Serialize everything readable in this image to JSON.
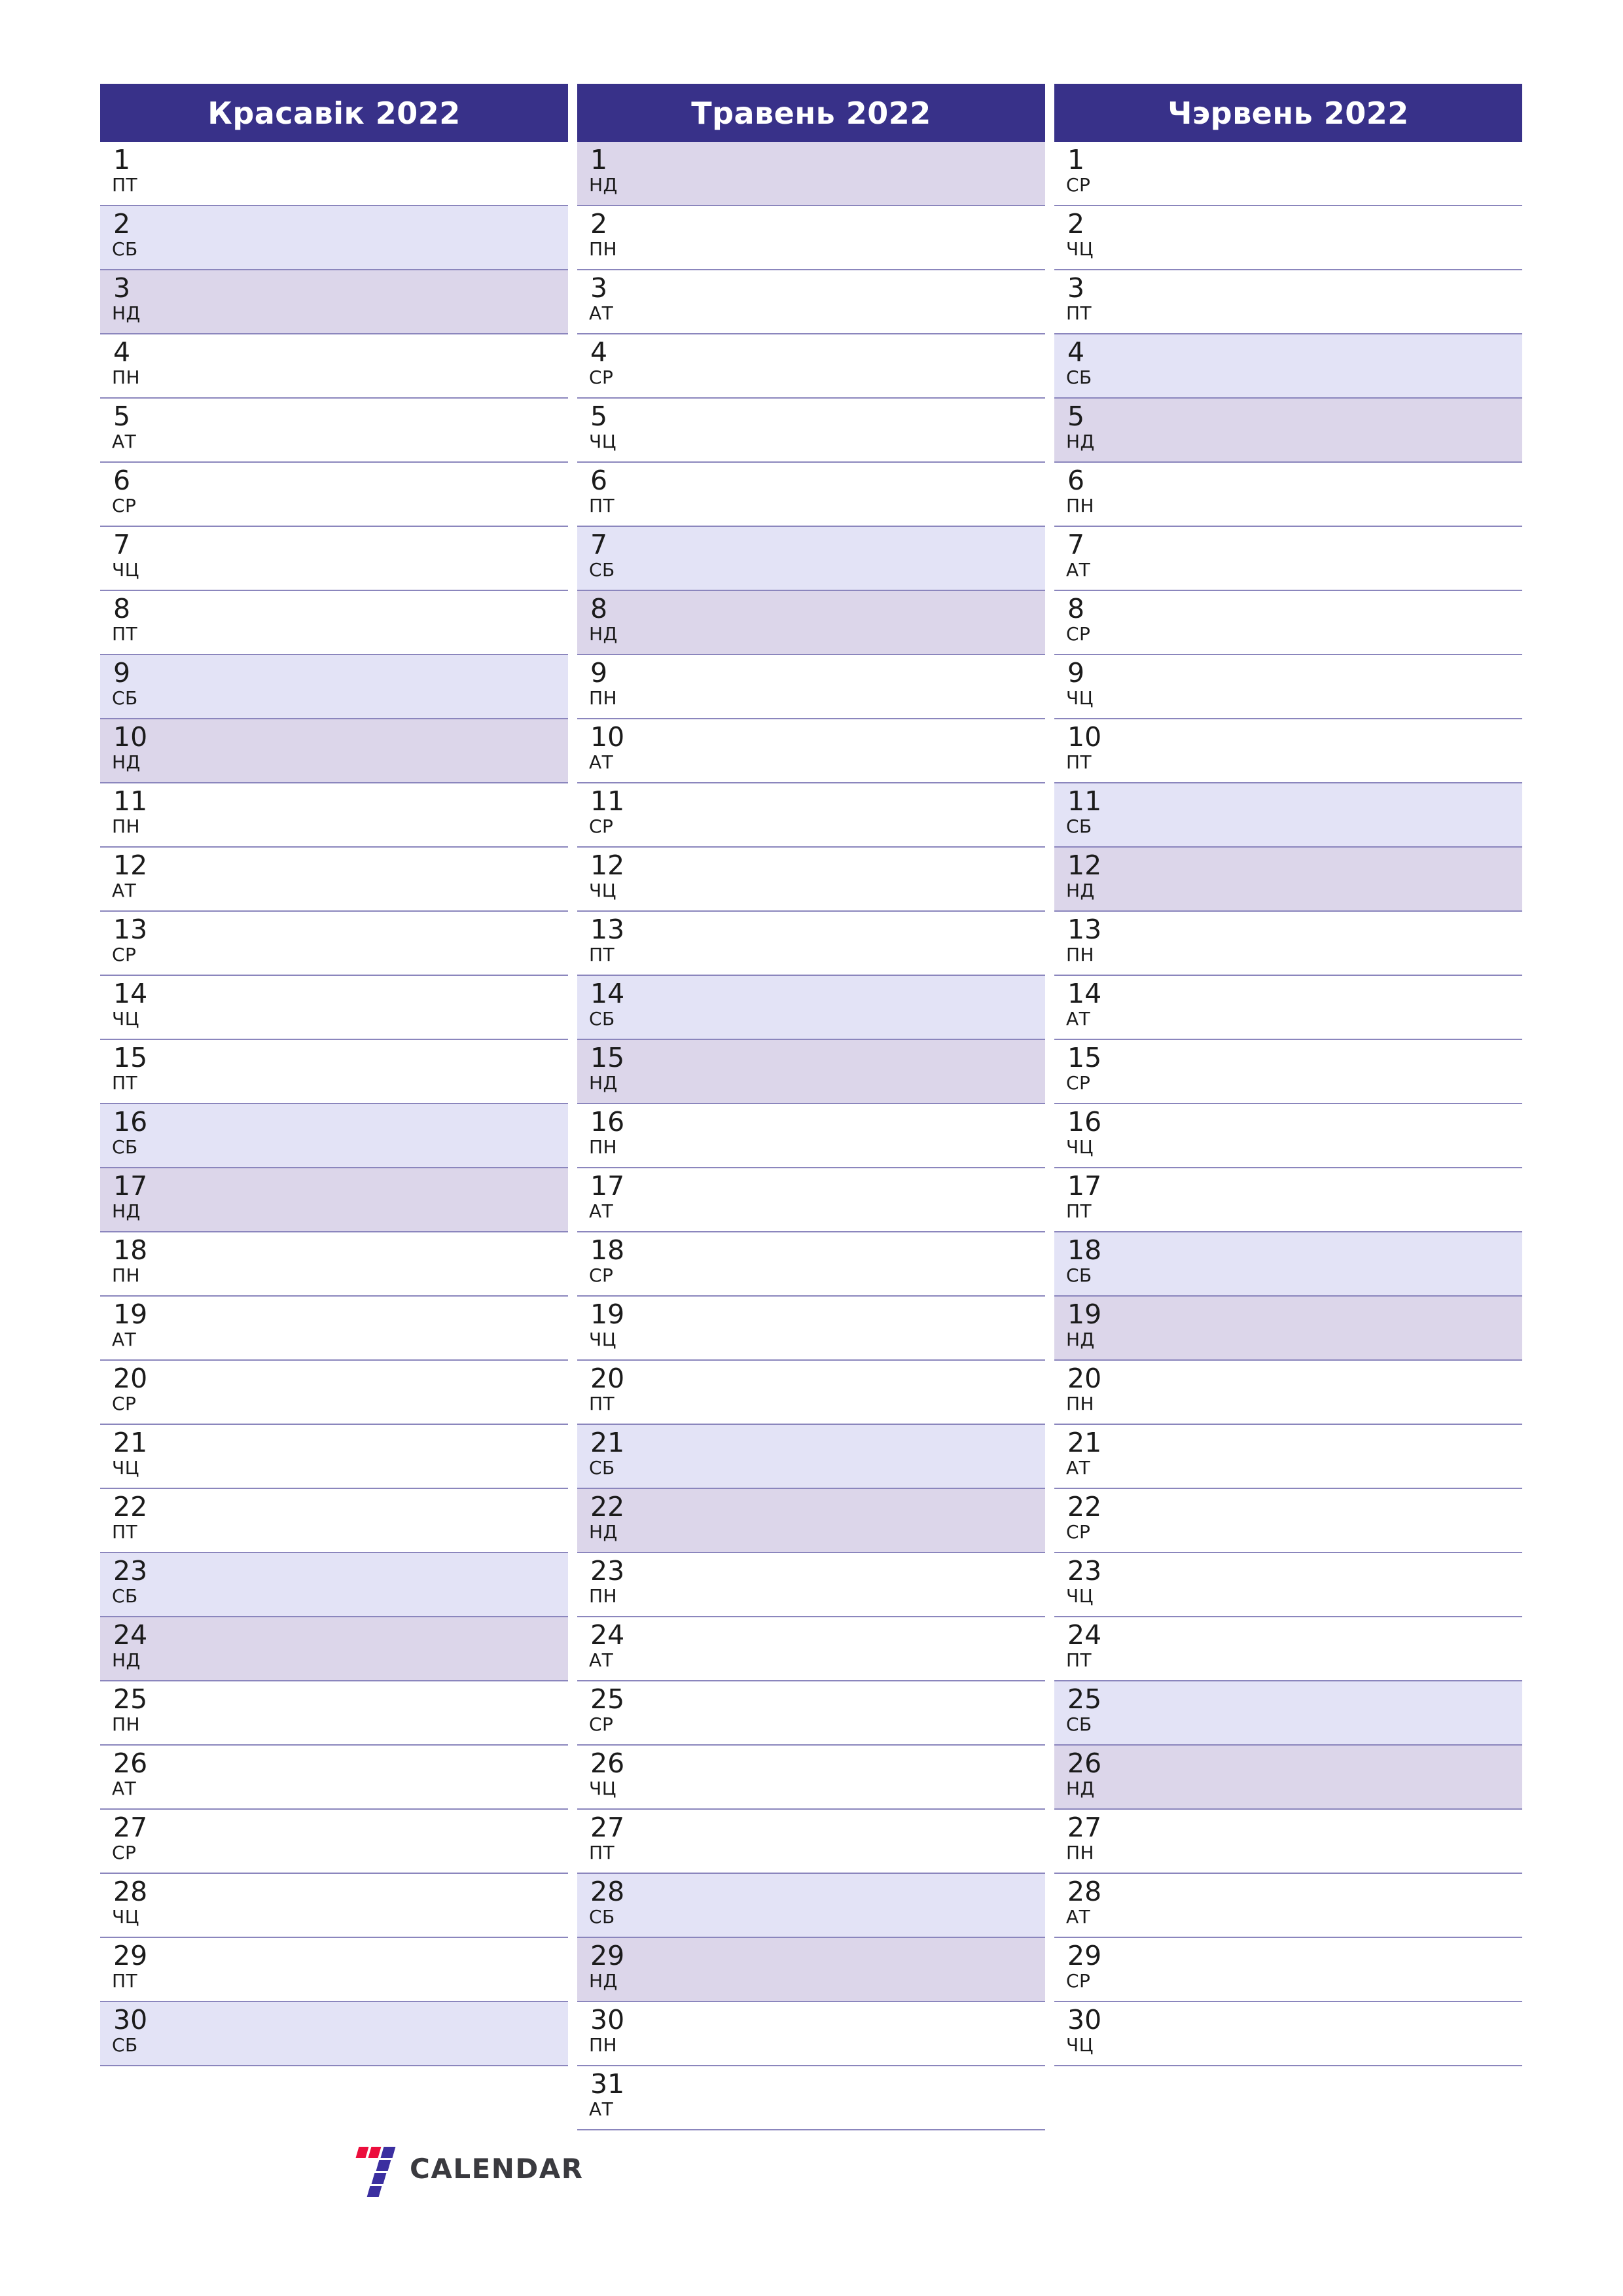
{
  "page": {
    "background_color": "#ffffff",
    "accent_color": "#383189",
    "saturday_color": "#e3e3f6",
    "sunday_color": "#dcd6ea",
    "divider_color": "#8b86bd",
    "text_color": "#1b1b1b"
  },
  "brand": {
    "logo_icon": "seven-calendar-logo-icon",
    "word": "CALENDAR",
    "mark_red": "#ec0e3c",
    "mark_purple": "#3b2fa0"
  },
  "months": [
    {
      "title": "Красавік 2022",
      "days": [
        {
          "num": "1",
          "dow": "ПТ",
          "kind": "weekday"
        },
        {
          "num": "2",
          "dow": "СБ",
          "kind": "sat"
        },
        {
          "num": "3",
          "dow": "НД",
          "kind": "sun"
        },
        {
          "num": "4",
          "dow": "ПН",
          "kind": "weekday"
        },
        {
          "num": "5",
          "dow": "АТ",
          "kind": "weekday"
        },
        {
          "num": "6",
          "dow": "СР",
          "kind": "weekday"
        },
        {
          "num": "7",
          "dow": "ЧЦ",
          "kind": "weekday"
        },
        {
          "num": "8",
          "dow": "ПТ",
          "kind": "weekday"
        },
        {
          "num": "9",
          "dow": "СБ",
          "kind": "sat"
        },
        {
          "num": "10",
          "dow": "НД",
          "kind": "sun"
        },
        {
          "num": "11",
          "dow": "ПН",
          "kind": "weekday"
        },
        {
          "num": "12",
          "dow": "АТ",
          "kind": "weekday"
        },
        {
          "num": "13",
          "dow": "СР",
          "kind": "weekday"
        },
        {
          "num": "14",
          "dow": "ЧЦ",
          "kind": "weekday"
        },
        {
          "num": "15",
          "dow": "ПТ",
          "kind": "weekday"
        },
        {
          "num": "16",
          "dow": "СБ",
          "kind": "sat"
        },
        {
          "num": "17",
          "dow": "НД",
          "kind": "sun"
        },
        {
          "num": "18",
          "dow": "ПН",
          "kind": "weekday"
        },
        {
          "num": "19",
          "dow": "АТ",
          "kind": "weekday"
        },
        {
          "num": "20",
          "dow": "СР",
          "kind": "weekday"
        },
        {
          "num": "21",
          "dow": "ЧЦ",
          "kind": "weekday"
        },
        {
          "num": "22",
          "dow": "ПТ",
          "kind": "weekday"
        },
        {
          "num": "23",
          "dow": "СБ",
          "kind": "sat"
        },
        {
          "num": "24",
          "dow": "НД",
          "kind": "sun"
        },
        {
          "num": "25",
          "dow": "ПН",
          "kind": "weekday"
        },
        {
          "num": "26",
          "dow": "АТ",
          "kind": "weekday"
        },
        {
          "num": "27",
          "dow": "СР",
          "kind": "weekday"
        },
        {
          "num": "28",
          "dow": "ЧЦ",
          "kind": "weekday"
        },
        {
          "num": "29",
          "dow": "ПТ",
          "kind": "weekday"
        },
        {
          "num": "30",
          "dow": "СБ",
          "kind": "sat"
        }
      ]
    },
    {
      "title": "Травень 2022",
      "days": [
        {
          "num": "1",
          "dow": "НД",
          "kind": "sun"
        },
        {
          "num": "2",
          "dow": "ПН",
          "kind": "weekday"
        },
        {
          "num": "3",
          "dow": "АТ",
          "kind": "weekday"
        },
        {
          "num": "4",
          "dow": "СР",
          "kind": "weekday"
        },
        {
          "num": "5",
          "dow": "ЧЦ",
          "kind": "weekday"
        },
        {
          "num": "6",
          "dow": "ПТ",
          "kind": "weekday"
        },
        {
          "num": "7",
          "dow": "СБ",
          "kind": "sat"
        },
        {
          "num": "8",
          "dow": "НД",
          "kind": "sun"
        },
        {
          "num": "9",
          "dow": "ПН",
          "kind": "weekday"
        },
        {
          "num": "10",
          "dow": "АТ",
          "kind": "weekday"
        },
        {
          "num": "11",
          "dow": "СР",
          "kind": "weekday"
        },
        {
          "num": "12",
          "dow": "ЧЦ",
          "kind": "weekday"
        },
        {
          "num": "13",
          "dow": "ПТ",
          "kind": "weekday"
        },
        {
          "num": "14",
          "dow": "СБ",
          "kind": "sat"
        },
        {
          "num": "15",
          "dow": "НД",
          "kind": "sun"
        },
        {
          "num": "16",
          "dow": "ПН",
          "kind": "weekday"
        },
        {
          "num": "17",
          "dow": "АТ",
          "kind": "weekday"
        },
        {
          "num": "18",
          "dow": "СР",
          "kind": "weekday"
        },
        {
          "num": "19",
          "dow": "ЧЦ",
          "kind": "weekday"
        },
        {
          "num": "20",
          "dow": "ПТ",
          "kind": "weekday"
        },
        {
          "num": "21",
          "dow": "СБ",
          "kind": "sat"
        },
        {
          "num": "22",
          "dow": "НД",
          "kind": "sun"
        },
        {
          "num": "23",
          "dow": "ПН",
          "kind": "weekday"
        },
        {
          "num": "24",
          "dow": "АТ",
          "kind": "weekday"
        },
        {
          "num": "25",
          "dow": "СР",
          "kind": "weekday"
        },
        {
          "num": "26",
          "dow": "ЧЦ",
          "kind": "weekday"
        },
        {
          "num": "27",
          "dow": "ПТ",
          "kind": "weekday"
        },
        {
          "num": "28",
          "dow": "СБ",
          "kind": "sat"
        },
        {
          "num": "29",
          "dow": "НД",
          "kind": "sun"
        },
        {
          "num": "30",
          "dow": "ПН",
          "kind": "weekday"
        },
        {
          "num": "31",
          "dow": "АТ",
          "kind": "weekday"
        }
      ]
    },
    {
      "title": "Чэрвень 2022",
      "days": [
        {
          "num": "1",
          "dow": "СР",
          "kind": "weekday"
        },
        {
          "num": "2",
          "dow": "ЧЦ",
          "kind": "weekday"
        },
        {
          "num": "3",
          "dow": "ПТ",
          "kind": "weekday"
        },
        {
          "num": "4",
          "dow": "СБ",
          "kind": "sat"
        },
        {
          "num": "5",
          "dow": "НД",
          "kind": "sun"
        },
        {
          "num": "6",
          "dow": "ПН",
          "kind": "weekday"
        },
        {
          "num": "7",
          "dow": "АТ",
          "kind": "weekday"
        },
        {
          "num": "8",
          "dow": "СР",
          "kind": "weekday"
        },
        {
          "num": "9",
          "dow": "ЧЦ",
          "kind": "weekday"
        },
        {
          "num": "10",
          "dow": "ПТ",
          "kind": "weekday"
        },
        {
          "num": "11",
          "dow": "СБ",
          "kind": "sat"
        },
        {
          "num": "12",
          "dow": "НД",
          "kind": "sun"
        },
        {
          "num": "13",
          "dow": "ПН",
          "kind": "weekday"
        },
        {
          "num": "14",
          "dow": "АТ",
          "kind": "weekday"
        },
        {
          "num": "15",
          "dow": "СР",
          "kind": "weekday"
        },
        {
          "num": "16",
          "dow": "ЧЦ",
          "kind": "weekday"
        },
        {
          "num": "17",
          "dow": "ПТ",
          "kind": "weekday"
        },
        {
          "num": "18",
          "dow": "СБ",
          "kind": "sat"
        },
        {
          "num": "19",
          "dow": "НД",
          "kind": "sun"
        },
        {
          "num": "20",
          "dow": "ПН",
          "kind": "weekday"
        },
        {
          "num": "21",
          "dow": "АТ",
          "kind": "weekday"
        },
        {
          "num": "22",
          "dow": "СР",
          "kind": "weekday"
        },
        {
          "num": "23",
          "dow": "ЧЦ",
          "kind": "weekday"
        },
        {
          "num": "24",
          "dow": "ПТ",
          "kind": "weekday"
        },
        {
          "num": "25",
          "dow": "СБ",
          "kind": "sat"
        },
        {
          "num": "26",
          "dow": "НД",
          "kind": "sun"
        },
        {
          "num": "27",
          "dow": "ПН",
          "kind": "weekday"
        },
        {
          "num": "28",
          "dow": "АТ",
          "kind": "weekday"
        },
        {
          "num": "29",
          "dow": "СР",
          "kind": "weekday"
        },
        {
          "num": "30",
          "dow": "ЧЦ",
          "kind": "weekday"
        }
      ]
    }
  ]
}
